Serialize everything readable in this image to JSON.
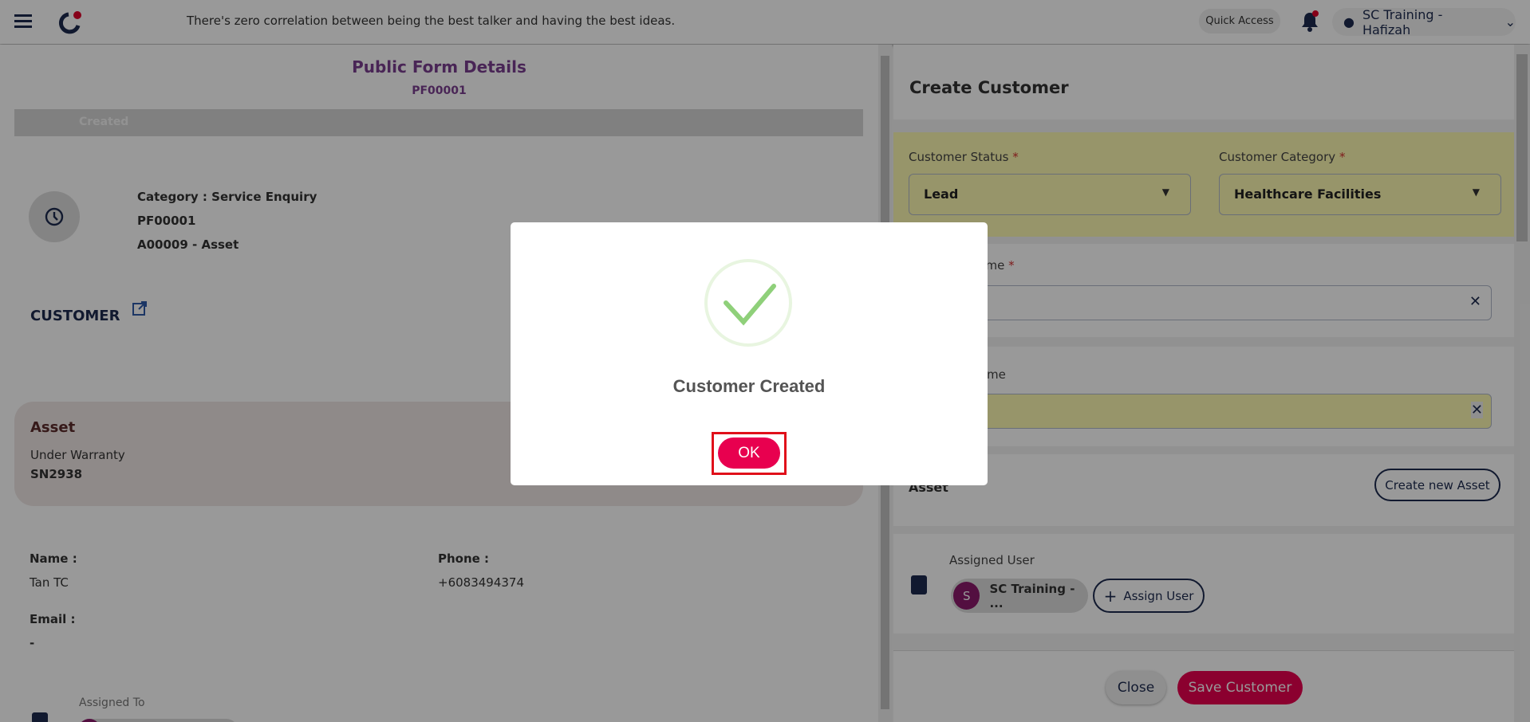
{
  "header": {
    "quote": "There's zero correlation between being the best talker and having the best ideas.",
    "quick_access": "Quick Access",
    "user": "SC Training - Hafizah"
  },
  "left": {
    "title": "Public Form Details",
    "form_id": "PF00001",
    "status": "Created",
    "category": "Category : Service Enquiry",
    "ref": "PF00001",
    "asset_ref": "A00009 - Asset",
    "customer_heading": "CUSTOMER",
    "asset_card": {
      "title": "Asset",
      "warranty": "Under Warranty",
      "serial": "SN2938"
    },
    "name_label": "Name :",
    "name_value": "Tan TC",
    "phone_label": "Phone :",
    "phone_value": "+6083494374",
    "email_label": "Email :",
    "email_value": "-",
    "assigned_to_label": "Assigned To"
  },
  "right": {
    "title": "Create Customer",
    "status_label": "Customer Status",
    "status_value": "Lead",
    "category_label": "Customer Category",
    "category_value": "Healthcare Facilities",
    "company_label": "Company Name",
    "customer_name_label": "Customer Name",
    "asset_label": "Asset",
    "create_asset": "Create new Asset",
    "assigned_user_label": "Assigned User",
    "user_chip_initial": "S",
    "user_chip": "SC Training - ...",
    "assign_user": "Assign User",
    "close": "Close",
    "save": "Save Customer",
    "required_mark": "*"
  },
  "modal": {
    "message": "Customer Created",
    "ok": "OK"
  },
  "colors": {
    "primary": "#e8004f",
    "navy": "#1d2b4f",
    "highlight": "#fcf8b1",
    "success": "#8fd07a"
  }
}
